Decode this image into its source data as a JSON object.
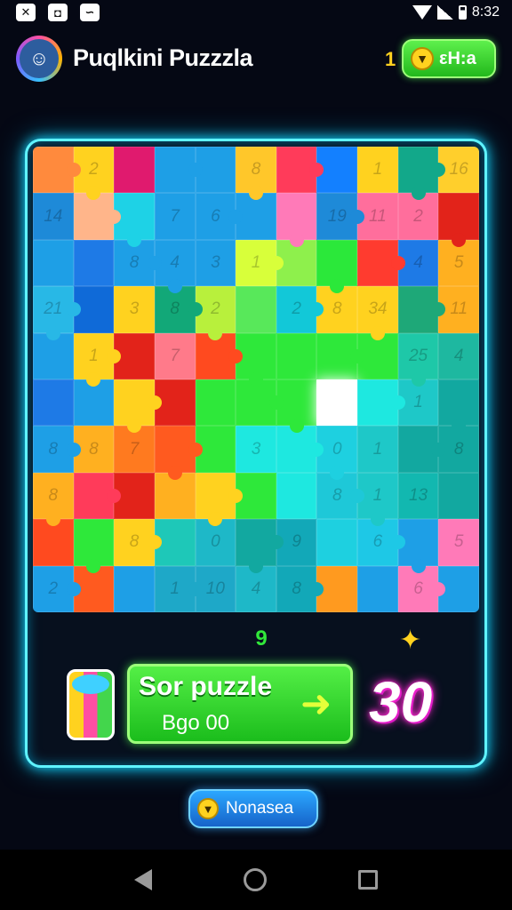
{
  "status_bar": {
    "time": "8:32",
    "left_icons": [
      "crossed-tools-icon",
      "messenger-icon",
      "chat-icon"
    ]
  },
  "header": {
    "title": "Puqlkini Puzzzla",
    "avatar_icon": "player-avatar-icon",
    "gem_count": "1",
    "gem_button_label": "εH:a"
  },
  "board": {
    "columns": 11,
    "rows": 10,
    "pieces": [
      {
        "c": "#ff8a3d",
        "n": ""
      },
      {
        "c": "#ffd21f",
        "n": "2"
      },
      {
        "c": "#e01a6e",
        "n": ""
      },
      {
        "c": "#1e9fe6",
        "n": ""
      },
      {
        "c": "#1e9fe6",
        "n": ""
      },
      {
        "c": "#ffc72a",
        "n": "8"
      },
      {
        "c": "#ff3b5a",
        "n": ""
      },
      {
        "c": "#1380ff",
        "n": ""
      },
      {
        "c": "#ffd21f",
        "n": "1"
      },
      {
        "c": "#12a88a",
        "n": ""
      },
      {
        "c": "#ffcf2c",
        "n": "16"
      },
      {
        "c": "#1e8ad8",
        "n": "14"
      },
      {
        "c": "#ffb58a",
        "n": ""
      },
      {
        "c": "#1ed2e6",
        "n": ""
      },
      {
        "c": "#1e9fe6",
        "n": "7"
      },
      {
        "c": "#1e9fe6",
        "n": "6"
      },
      {
        "c": "#1e9fe6",
        "n": ""
      },
      {
        "c": "#ff7ab8",
        "n": ""
      },
      {
        "c": "#1e8ad8",
        "n": "19"
      },
      {
        "c": "#ff6e9c",
        "n": "11"
      },
      {
        "c": "#ff6e9c",
        "n": "2"
      },
      {
        "c": "#e2231a",
        "n": ""
      },
      {
        "c": "#1e9fe6",
        "n": ""
      },
      {
        "c": "#1e7ae6",
        "n": ""
      },
      {
        "c": "#1e9fe6",
        "n": "8"
      },
      {
        "c": "#1e9fe6",
        "n": "4"
      },
      {
        "c": "#1e9fe6",
        "n": "3"
      },
      {
        "c": "#d8ff3a",
        "n": "1"
      },
      {
        "c": "#8ef04c",
        "n": ""
      },
      {
        "c": "#2be83a",
        "n": ""
      },
      {
        "c": "#ff3b2f",
        "n": ""
      },
      {
        "c": "#1e7ae6",
        "n": "4"
      },
      {
        "c": "#ffb020",
        "n": "5"
      },
      {
        "c": "#28b8e6",
        "n": "21"
      },
      {
        "c": "#0f6ad8",
        "n": ""
      },
      {
        "c": "#ffd21f",
        "n": "3"
      },
      {
        "c": "#12a878",
        "n": "8"
      },
      {
        "c": "#b8f03c",
        "n": "2"
      },
      {
        "c": "#58e85a",
        "n": ""
      },
      {
        "c": "#12c8d8",
        "n": "2"
      },
      {
        "c": "#ffd21f",
        "n": "8"
      },
      {
        "c": "#ffd21f",
        "n": "34"
      },
      {
        "c": "#1ea878",
        "n": ""
      },
      {
        "c": "#ffb020",
        "n": "11"
      },
      {
        "c": "#1e9fe6",
        "n": ""
      },
      {
        "c": "#ffd21f",
        "n": "1"
      },
      {
        "c": "#e2231a",
        "n": ""
      },
      {
        "c": "#ff7a8a",
        "n": "7"
      },
      {
        "c": "#ff4a1f",
        "n": ""
      },
      {
        "c": "#2ee83a",
        "n": ""
      },
      {
        "c": "#2ee83a",
        "n": ""
      },
      {
        "c": "#2ee83a",
        "n": ""
      },
      {
        "c": "#2ee83a",
        "n": ""
      },
      {
        "c": "#1ec8a8",
        "n": "25"
      },
      {
        "c": "#1eb8a0",
        "n": "4"
      },
      {
        "c": "#1e7ae6",
        "n": ""
      },
      {
        "c": "#1e9fe6",
        "n": ""
      },
      {
        "c": "#ffd21f",
        "n": ""
      },
      {
        "c": "#e2231a",
        "n": ""
      },
      {
        "c": "#2ee83a",
        "n": ""
      },
      {
        "c": "#2ee83a",
        "n": ""
      },
      {
        "c": "#2ee83a",
        "n": ""
      },
      {
        "c": "#ffffff",
        "n": "",
        "empty": true
      },
      {
        "c": "#1ee8e0",
        "n": ""
      },
      {
        "c": "#1ec8c8",
        "n": "1"
      },
      {
        "c": "#12a8a0",
        "n": ""
      },
      {
        "c": "#1e9fe6",
        "n": "8"
      },
      {
        "c": "#ffb020",
        "n": "8"
      },
      {
        "c": "#ff7a1f",
        "n": "7"
      },
      {
        "c": "#ff5a1f",
        "n": ""
      },
      {
        "c": "#2ee83a",
        "n": ""
      },
      {
        "c": "#1ee8e0",
        "n": "3"
      },
      {
        "c": "#1ee8e0",
        "n": ""
      },
      {
        "c": "#1ed0e0",
        "n": "0"
      },
      {
        "c": "#1ec8c8",
        "n": "1"
      },
      {
        "c": "#12a8a0",
        "n": ""
      },
      {
        "c": "#12a8a0",
        "n": "8"
      },
      {
        "c": "#ffb020",
        "n": "8"
      },
      {
        "c": "#ff3b5a",
        "n": ""
      },
      {
        "c": "#e2231a",
        "n": ""
      },
      {
        "c": "#ffb020",
        "n": ""
      },
      {
        "c": "#ffd21f",
        "n": ""
      },
      {
        "c": "#2ee83a",
        "n": ""
      },
      {
        "c": "#1ee8e0",
        "n": ""
      },
      {
        "c": "#1ec8d8",
        "n": "8"
      },
      {
        "c": "#1ec8c8",
        "n": "1"
      },
      {
        "c": "#12b8b0",
        "n": "13"
      },
      {
        "c": "#12a8a0",
        "n": ""
      },
      {
        "c": "#ff4a1f",
        "n": ""
      },
      {
        "c": "#2ee83a",
        "n": ""
      },
      {
        "c": "#ffd21f",
        "n": "8"
      },
      {
        "c": "#1ec8b8",
        "n": ""
      },
      {
        "c": "#1eb8c8",
        "n": "0"
      },
      {
        "c": "#12a8a0",
        "n": ""
      },
      {
        "c": "#12a8b8",
        "n": "9"
      },
      {
        "c": "#1ed0e0",
        "n": ""
      },
      {
        "c": "#1ec8e6",
        "n": "6"
      },
      {
        "c": "#1e9fe6",
        "n": ""
      },
      {
        "c": "#ff7ab8",
        "n": "5"
      },
      {
        "c": "#1e9fe6",
        "n": "2"
      },
      {
        "c": "#ff5a1f",
        "n": ""
      },
      {
        "c": "#1e9fe6",
        "n": ""
      },
      {
        "c": "#1ea8c8",
        "n": "1"
      },
      {
        "c": "#1ea8c8",
        "n": "10"
      },
      {
        "c": "#1eb8c8",
        "n": "4"
      },
      {
        "c": "#12a8b8",
        "n": "8"
      },
      {
        "c": "#ff9a1f",
        "n": ""
      },
      {
        "c": "#1e9fe6",
        "n": ""
      },
      {
        "c": "#ff7ab8",
        "n": "6"
      },
      {
        "c": "#1e9fe6",
        "n": ""
      }
    ]
  },
  "moves_count": "9",
  "star_icon": "sparkle-star-icon",
  "action_button": {
    "title": "Sor puzzle",
    "subtitle": "Bgo 00",
    "arrow_icon": "arrow-right-icon"
  },
  "battery_icon": "battery-cup-icon",
  "score": "30",
  "bottom_pill": {
    "label": "Nonasea",
    "gem_icon": "gem-icon"
  },
  "nav": [
    "back",
    "home",
    "recent-apps"
  ],
  "colors": {
    "accent": "#5ff3ff",
    "button_green": "#2ee83a",
    "score_glow": "#ff2bd0",
    "gem_gold": "#ffd21f"
  }
}
